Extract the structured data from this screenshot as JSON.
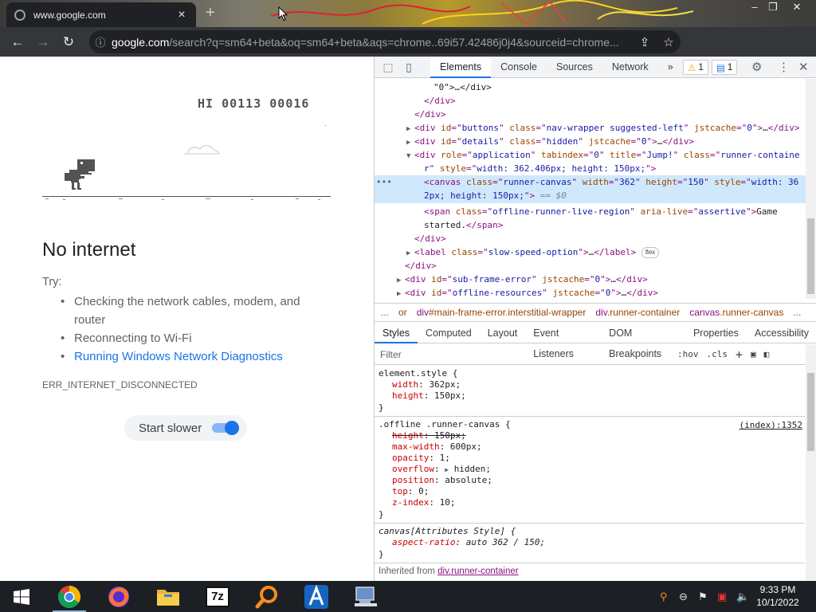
{
  "browser": {
    "tab_title": "www.google.com",
    "tab_close": "×",
    "new_tab": "+",
    "url_host": "google.com",
    "url_rest": "/search?q=sm64+beta&oq=sm64+beta&aqs=chrome..69i57.42486j0j4&sourceid=chrome...",
    "win_min": "–",
    "win_max": "❐",
    "win_close": "✕"
  },
  "page": {
    "score_text": "HI 00113 00016",
    "heading": "No internet",
    "try_label": "Try:",
    "suggestions": [
      "Checking the network cables, modem, and router",
      "Reconnecting to Wi-Fi",
      "Running Windows Network Diagnostics"
    ],
    "error_code": "ERR_INTERNET_DISCONNECTED",
    "start_slower_label": "Start slower",
    "start_slower_enabled": true
  },
  "devtools": {
    "tabs": [
      "Elements",
      "Console",
      "Sources",
      "Network"
    ],
    "more": "»",
    "warn_count": "1",
    "msg_count": "1",
    "elements_lines": {
      "l0": "\"0\">…</div>",
      "l1": "</div>",
      "l2": "</div>",
      "l3_tag": "div",
      "l3_id": "buttons",
      "l3_class": "nav-wrapper suggested-left",
      "l3_jst": "0",
      "l4_tag": "div",
      "l4_id": "details",
      "l4_class": "hidden",
      "l4_jst": "0",
      "l5_role": "application",
      "l5_tab": "0",
      "l5_title": "Jump!",
      "l5_class_a": "runner-containe",
      "l5_class_b": "r",
      "l5_style": "width: 362.406px; height: 150px;",
      "l6_class": "runner-canvas",
      "l6_width": "362",
      "l6_height": "150",
      "l6_style_a": "width: 36",
      "l6_style_b": "2px; height: 150px;",
      "l6_eq": "== $0",
      "l7_class": "offline-runner-live-region",
      "l7_live": "assertive",
      "l7_text_a": "Game",
      "l7_text_b": "started.",
      "l8": "</div>",
      "l9_class": "slow-speed-option",
      "l9_pill": "flex",
      "l10": "</div>",
      "l11_id": "sub-frame-error",
      "l11_jst": "0",
      "l12_id": "offline-resources",
      "l12_jst": "0"
    },
    "breadcrumb": {
      "more": "...",
      "c0": "or",
      "c1_tag": "div",
      "c1_rest": "#main-frame-error.interstitial-wrapper",
      "c2_tag": "div",
      "c2_rest": ".runner-container",
      "c3_tag": "canvas",
      "c3_rest": ".runner-canvas",
      "end": "..."
    },
    "subtabs": [
      "Styles",
      "Computed",
      "Layout",
      "Event Listeners",
      "DOM Breakpoints",
      "Properties",
      "Accessibility"
    ],
    "filter_placeholder": "Filter",
    "hov": ":hov",
    "cls": ".cls",
    "rules": {
      "r0_sel": "element.style {",
      "r0_p0": "width",
      "r0_v0": "362px;",
      "r0_p1": "height",
      "r0_v1": "150px;",
      "close": "}",
      "r1_sel": ".offline .runner-canvas {",
      "r1_src": "(index):1352",
      "r1_p0": "height",
      "r1_v0": "150px;",
      "r1_p1": "max-width",
      "r1_v1": "600px;",
      "r1_p2": "opacity",
      "r1_v2": "1;",
      "r1_p3": "overflow",
      "r1_v3": "hidden;",
      "r1_p4": "position",
      "r1_v4": "absolute;",
      "r1_p5": "top",
      "r1_v5": "0;",
      "r1_p6": "z-index",
      "r1_v6": "10;",
      "r2_sel": "canvas[Attributes Style] {",
      "r2_p0": "aspect-ratio",
      "r2_v0": "auto 362 / 150;"
    },
    "inherited_label": "Inherited from",
    "inherited_from": "div.runner-container"
  },
  "taskbar": {
    "time": "9:33 PM",
    "date": "10/1/2022",
    "sevenzip_label": "7z"
  }
}
